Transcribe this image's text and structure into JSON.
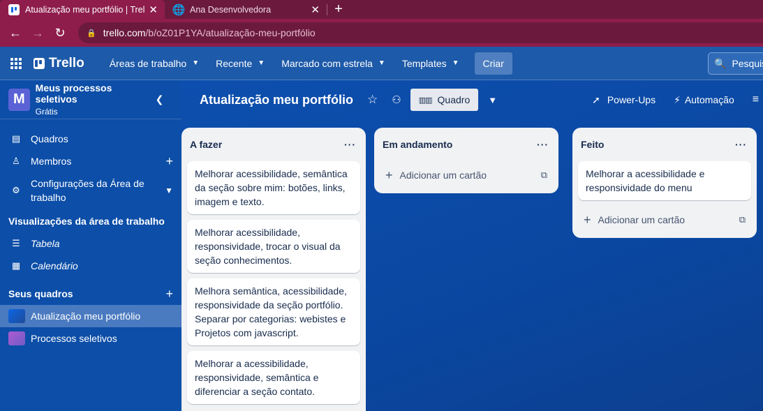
{
  "browser": {
    "tabs": [
      {
        "title": "Atualização meu portfólio | Trello",
        "favicon": "trello-icon",
        "active": true
      },
      {
        "title": "Ana Desenvolvedora",
        "favicon": "globe-icon",
        "active": false
      }
    ],
    "new_tab_symbol": "+",
    "url_host": "trello.com",
    "url_path": "/b/oZ01P1YA/atualização-meu-portfólio"
  },
  "header": {
    "logo_text": "Trello",
    "menu": [
      {
        "label": "Áreas de trabalho"
      },
      {
        "label": "Recente"
      },
      {
        "label": "Marcado com estrela"
      },
      {
        "label": "Templates"
      }
    ],
    "create_label": "Criar",
    "search_placeholder": "Pesquisar"
  },
  "sidebar": {
    "workspace_initial": "M",
    "workspace_name": "Meus processos seletivos",
    "workspace_plan": "Grátis",
    "nav": [
      {
        "label": "Quadros"
      },
      {
        "label": "Membros"
      },
      {
        "label": "Configurações da Área de trabalho"
      }
    ],
    "views_title": "Visualizações da área de trabalho",
    "views": [
      {
        "label": "Tabela"
      },
      {
        "label": "Calendário"
      }
    ],
    "boards_title": "Seus quadros",
    "boards": [
      {
        "label": "Atualização meu portfólio",
        "selected": true
      },
      {
        "label": "Processos seletivos",
        "selected": false
      }
    ]
  },
  "board": {
    "title": "Atualização meu portfólio",
    "view_label": "Quadro",
    "powerups_label": "Power-Ups",
    "automation_label": "Automação",
    "add_card_label": "Adicionar um cartão",
    "lists": [
      {
        "title": "A fazer",
        "cards": [
          "Melhorar acessibilidade, semântica da seção sobre mim: botões, links, imagem e texto.",
          "Melhorar acessibilidade, responsividade, trocar o visual da seção conhecimentos.",
          "Melhora semântica, acessibilidade, responsividade da seção portfólio. Separar por categorias: webistes e Projetos com javascript.",
          "Melhorar a acessibilidade, responsividade, semântica e diferenciar a seção contato."
        ]
      },
      {
        "title": "Em andamento",
        "cards": []
      },
      {
        "title": "Feito",
        "cards": [
          "Melhorar a acessibilidade e responsividade do menu"
        ]
      }
    ]
  },
  "colors": {
    "browser_tabstrip": "#6b1a3e",
    "browser_toolbar": "#8e1d4c",
    "trello_header": "#1d5aa9",
    "sidebar": "#0c4ea8",
    "board_bg": "#0a4dab",
    "list_bg": "#f1f2f4"
  }
}
